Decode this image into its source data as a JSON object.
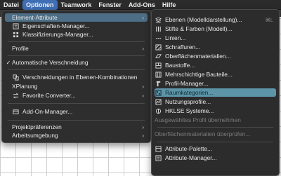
{
  "menubar": {
    "items": [
      "Datei",
      "Optionen",
      "Teamwork",
      "Fenster",
      "Add-Ons",
      "Hilfe"
    ],
    "active_index": 1
  },
  "main_menu": {
    "items": [
      {
        "label": "Element-Attribute",
        "submenu": true,
        "highlighted": true
      },
      {
        "label": "Eigenschaften-Manager..."
      },
      {
        "label": "Klassifizierungs-Manager..."
      },
      {
        "label": "Profile",
        "submenu": true
      },
      {
        "label": "Automatische Verschneidung",
        "check": "✓"
      },
      {
        "label": "Verschneidungen in Ebenen-Kombinationen"
      },
      {
        "label": "XPlanung",
        "submenu": true
      },
      {
        "label": "Favorite Converter...",
        "submenu": true
      },
      {
        "label": "Add-On-Manager..."
      },
      {
        "label": "Projektpräferenzen",
        "submenu": true
      },
      {
        "label": "Arbeitsumgebung",
        "submenu": true
      }
    ]
  },
  "sub_menu": {
    "items": [
      {
        "label": "Ebenen (Modelldarstellung)...",
        "shortcut": "⌘L"
      },
      {
        "label": "Stifte & Farben (Modell)..."
      },
      {
        "label": "Linien..."
      },
      {
        "label": "Schraffuren..."
      },
      {
        "label": "Oberflächenmaterialien..."
      },
      {
        "label": "Baustoffe..."
      },
      {
        "label": "Mehrschichtige Bauteile..."
      },
      {
        "label": "Profil-Manager..."
      },
      {
        "label": "Raumkategorien...",
        "highlighted": true
      },
      {
        "label": "Nutzungsprofile..."
      },
      {
        "label": "HKLSE Systeme..."
      },
      {
        "label": "Ausgewähltes Profil übernehmen",
        "disabled": true
      },
      {
        "label": "Oberflächenmaterialien überprüfen...",
        "disabled": true
      },
      {
        "label": "Attribute-Palette..."
      },
      {
        "label": "Attribute-Manager..."
      }
    ]
  },
  "colors": {
    "menubar_bg": "#2b2b2b",
    "menu_bg": "#2e2e2e",
    "highlight_main": "#4d6e86",
    "highlight_sub": "#5d95a8",
    "active_menu": "#3f6fb5"
  }
}
